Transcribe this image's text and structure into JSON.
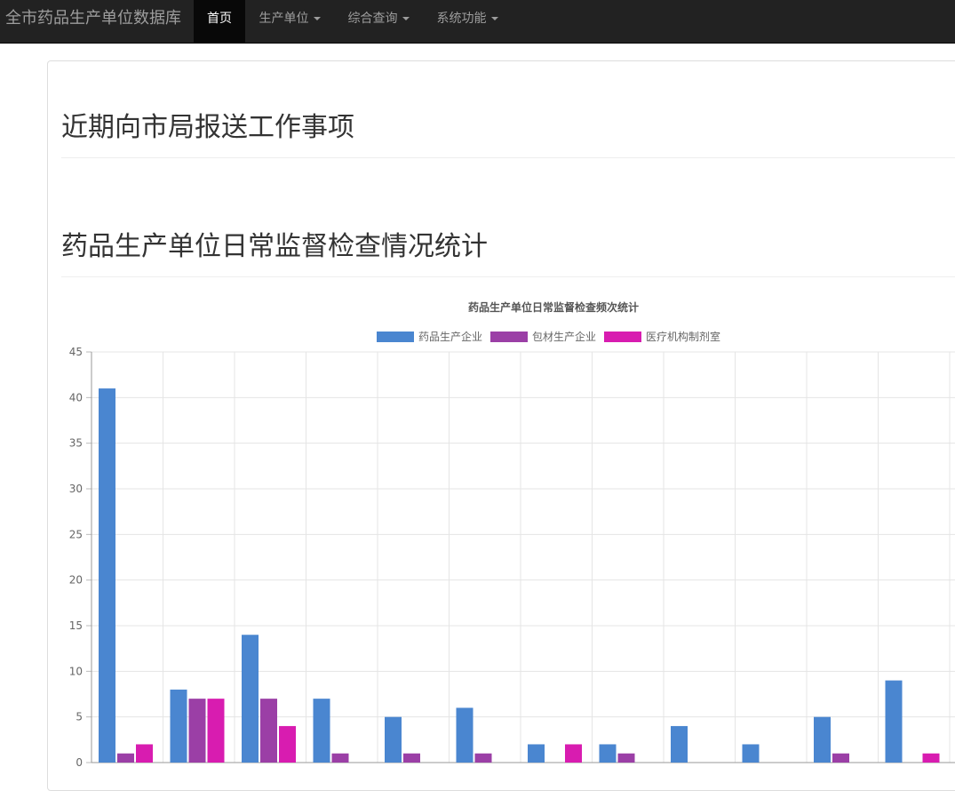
{
  "navbar": {
    "brand": "全市药品生产单位数据库",
    "items": [
      {
        "label": "首页",
        "active": true,
        "dropdown": false
      },
      {
        "label": "生产单位",
        "active": false,
        "dropdown": true
      },
      {
        "label": "综合查询",
        "active": false,
        "dropdown": true
      },
      {
        "label": "系统功能",
        "active": false,
        "dropdown": true
      }
    ]
  },
  "sections": {
    "report_title": "近期向市局报送工作事项",
    "stats_title": "药品生产单位日常监督检查情况统计"
  },
  "chart_data": {
    "type": "bar",
    "title": "药品生产单位日常监督检查频次统计",
    "legend_position": "top",
    "ylim": [
      0,
      45
    ],
    "yticks": [
      0,
      5,
      10,
      15,
      20,
      25,
      30,
      35,
      40,
      45
    ],
    "grid": true,
    "categories": [
      "",
      "",
      "",
      "",
      "",
      "",
      "",
      "",
      "",
      "",
      "",
      ""
    ],
    "series": [
      {
        "name": "药品生产企业",
        "color": "#4a86d0",
        "values": [
          41,
          8,
          14,
          7,
          5,
          6,
          2,
          2,
          4,
          2,
          5,
          9
        ]
      },
      {
        "name": "包材生产企业",
        "color": "#9b3fa6",
        "values": [
          1,
          7,
          7,
          1,
          1,
          1,
          0,
          1,
          0,
          0,
          1,
          0
        ]
      },
      {
        "name": "医疗机构制剂室",
        "color": "#d81cb0",
        "values": [
          2,
          7,
          4,
          0,
          0,
          0,
          2,
          0,
          0,
          0,
          0,
          1
        ]
      }
    ]
  }
}
